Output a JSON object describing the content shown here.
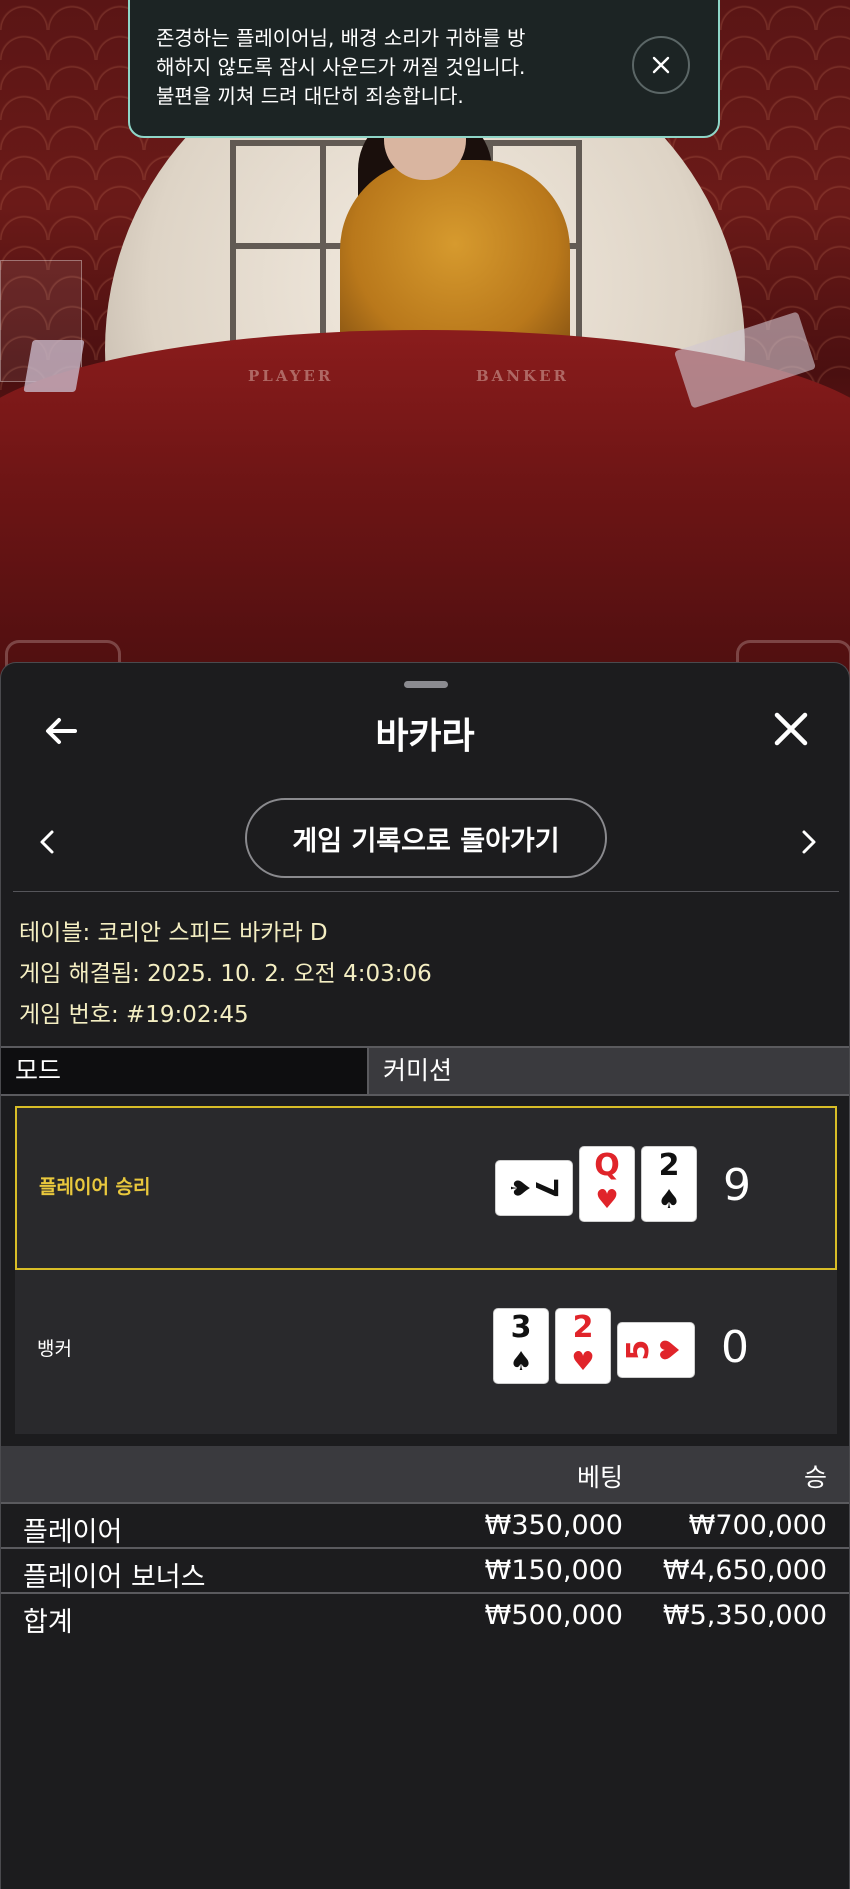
{
  "video": {
    "table_labels": {
      "player": "PLAYER",
      "banker": "BANKER"
    }
  },
  "toast": {
    "message": "존경하는 플레이어님, 배경 소리가 귀하를 방\n해하지 않도록 잠시 사운드가 꺼질 것입니다.\n불편을 끼쳐 드려 대단히 죄송합니다.",
    "close_icon": "close-icon"
  },
  "sheet": {
    "title": "바카라",
    "back_icon": "arrow-left-icon",
    "close_icon": "close-icon",
    "history_button": "게임 기록으로 돌아가기",
    "nav_prev_icon": "chevron-left-icon",
    "nav_next_icon": "chevron-right-icon"
  },
  "game_info": {
    "table": "테이블: 코리안 스피드 바카라 D",
    "resolved": "게임 해결됨: 2025. 10. 2. 오전 4:03:06",
    "game_number": "게임 번호: #19:02:45"
  },
  "mode": {
    "label": "모드",
    "value": "커미션"
  },
  "results": {
    "player": {
      "label": "플레이어 승리",
      "score": "9",
      "cards": [
        {
          "rank": "7",
          "suit": "♠",
          "color": "#111111",
          "sideways": true
        },
        {
          "rank": "Q",
          "suit": "♥",
          "color": "#e0242a",
          "sideways": false
        },
        {
          "rank": "2",
          "suit": "♠",
          "color": "#111111",
          "sideways": false
        }
      ]
    },
    "banker": {
      "label": "뱅커",
      "score": "0",
      "cards": [
        {
          "rank": "3",
          "suit": "♠",
          "color": "#111111",
          "sideways": false
        },
        {
          "rank": "2",
          "suit": "♥",
          "color": "#e0242a",
          "sideways": false
        },
        {
          "rank": "5",
          "suit": "♥",
          "color": "#e0242a",
          "sideways": true
        }
      ]
    }
  },
  "bets": {
    "headers": {
      "bet": "베팅",
      "win": "승"
    },
    "rows": [
      {
        "name": "플레이어",
        "bet": "₩350,000",
        "win": "₩700,000"
      },
      {
        "name": "플레이어 보너스",
        "bet": "₩150,000",
        "win": "₩4,650,000"
      },
      {
        "name": "합계",
        "bet": "₩500,000",
        "win": "₩5,350,000"
      }
    ]
  },
  "colors": {
    "accent_gold": "#d8bd27",
    "toast_border": "#8fd6c8",
    "info_text": "#f4eec2"
  }
}
